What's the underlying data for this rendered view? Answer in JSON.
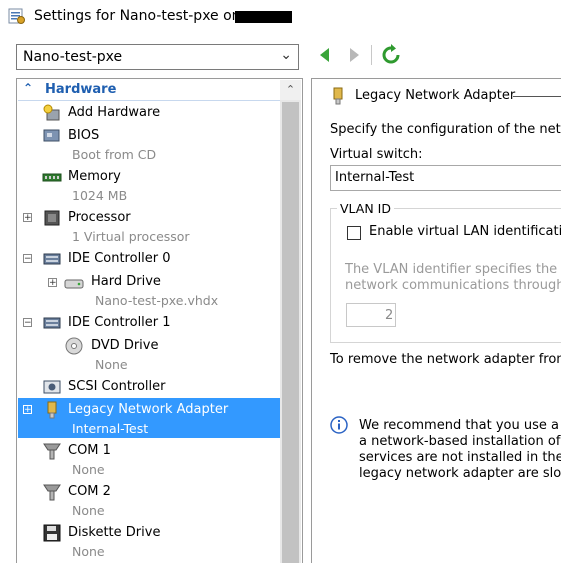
{
  "window": {
    "title": "Settings for Nano-test-pxe on",
    "title_icon": "settings-window-icon"
  },
  "vm_selector": {
    "value": "Nano-test-pxe"
  },
  "toolbar": {
    "back_icon": "back-arrow-icon",
    "forward_icon": "forward-arrow-icon",
    "refresh_icon": "refresh-icon"
  },
  "tree": {
    "section": "Hardware",
    "items": [
      {
        "label": "Add Hardware",
        "sub": ""
      },
      {
        "label": "BIOS",
        "sub": "Boot from CD"
      },
      {
        "label": "Memory",
        "sub": "1024 MB"
      },
      {
        "label": "Processor",
        "sub": "1 Virtual processor"
      },
      {
        "label": "IDE Controller 0",
        "sub": ""
      },
      {
        "label": "Hard Drive",
        "sub": "Nano-test-pxe.vhdx"
      },
      {
        "label": "IDE Controller 1",
        "sub": ""
      },
      {
        "label": "DVD Drive",
        "sub": "None"
      },
      {
        "label": "SCSI Controller",
        "sub": ""
      },
      {
        "label": "Legacy Network Adapter",
        "sub": "Internal-Test"
      },
      {
        "label": "COM 1",
        "sub": "None"
      },
      {
        "label": "COM 2",
        "sub": "None"
      },
      {
        "label": "Diskette Drive",
        "sub": "None"
      }
    ]
  },
  "detail": {
    "heading": "Legacy Network Adapter",
    "description": "Specify the configuration of the netwo",
    "virtual_switch_label": "Virtual switch:",
    "virtual_switch_value": "Internal-Test",
    "vlan_group_label": "VLAN ID",
    "vlan_checkbox_label": "Enable virtual LAN identification",
    "vlan_help_line1": "The VLAN identifier specifies the virt",
    "vlan_help_line2": "network communications through thi",
    "vlan_value": "2",
    "remove_text": "To remove the network adapter from t",
    "info_line1": "We recommend that you use a leg",
    "info_line2": "a network-based installation of th",
    "info_line3": "services are not installed in the gu",
    "info_line4": "legacy network adapter are slowe"
  },
  "colors": {
    "selection": "#3399ff",
    "section_header": "#1f5fb0",
    "nav_green": "#3aa53a"
  }
}
